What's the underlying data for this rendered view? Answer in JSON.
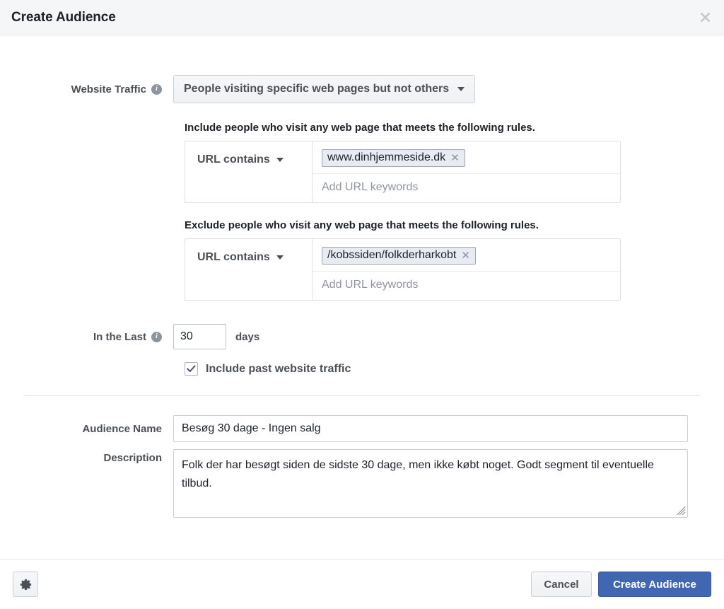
{
  "header": {
    "title": "Create Audience",
    "close_icon": "close-icon"
  },
  "website_traffic": {
    "label": "Website Traffic",
    "info_icon": "info-icon",
    "selected_option": "People visiting specific web pages but not others",
    "caret_icon": "chevron-down-icon"
  },
  "include_rules": {
    "heading": "Include people who visit any web page that meets the following rules.",
    "rule_type": "URL contains",
    "caret_icon": "chevron-down-icon",
    "tokens": [
      {
        "value": "www.dinhjemmeside.dk",
        "remove_icon": "remove-token-icon"
      }
    ],
    "keywords_placeholder": "Add URL keywords"
  },
  "exclude_rules": {
    "heading": "Exclude people who visit any web page that meets the following rules.",
    "rule_type": "URL contains",
    "caret_icon": "chevron-down-icon",
    "tokens": [
      {
        "value": "/kobssiden/folkderharkobt",
        "remove_icon": "remove-token-icon"
      }
    ],
    "keywords_placeholder": "Add URL keywords"
  },
  "retention": {
    "label": "In the Last",
    "info_icon": "info-icon",
    "days_value": "30",
    "days_unit": "days",
    "include_past_checked": true,
    "include_past_label": "Include past website traffic",
    "check_icon": "check-icon"
  },
  "audience": {
    "name_label": "Audience Name",
    "name_value": "Besøg 30 dage - Ingen salg",
    "description_label": "Description",
    "description_value": "Folk der har besøgt siden de sidste 30 dage, men ikke købt noget. Godt segment til eventuelle tilbud.",
    "resize_icon": "resize-grip-icon"
  },
  "footer": {
    "settings_icon": "gear-icon",
    "cancel_label": "Cancel",
    "submit_label": "Create Audience"
  },
  "colors": {
    "primary": "#4267b2",
    "header_bg": "#f5f6f7",
    "label_text": "#4b4f56",
    "token_bg": "#e9ebf2",
    "token_border": "#9aa5bd",
    "placeholder": "#90949c"
  }
}
